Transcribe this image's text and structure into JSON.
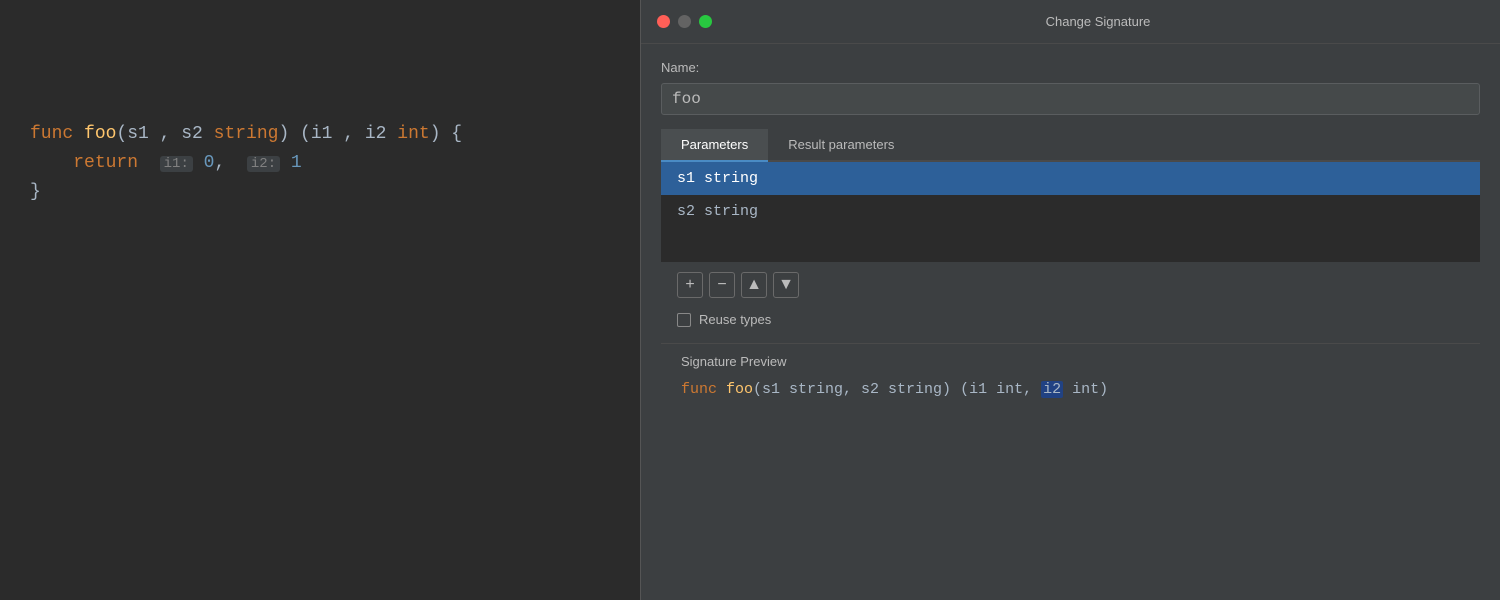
{
  "editor": {
    "lines": [
      {
        "id": "line1",
        "content": ""
      },
      {
        "id": "line2",
        "content": ""
      },
      {
        "id": "line3",
        "content": ""
      },
      {
        "id": "line4",
        "content": "func foo(s1 , s2 string) (i1 , i2 int) {"
      },
      {
        "id": "line5",
        "content": "    return  i1: 0,  i2: 1"
      },
      {
        "id": "line6",
        "content": "}"
      }
    ]
  },
  "dialog": {
    "title": "Change Signature",
    "title_bar_buttons": {
      "close": "close",
      "minimize": "minimize",
      "maximize": "maximize"
    },
    "name_label": "Name:",
    "name_value": "foo",
    "tabs": [
      {
        "id": "parameters",
        "label": "Parameters",
        "active": true
      },
      {
        "id": "result_parameters",
        "label": "Result parameters",
        "active": false
      }
    ],
    "parameters": [
      {
        "id": "p1",
        "value": "s1 string",
        "selected": true
      },
      {
        "id": "p2",
        "value": "s2 string",
        "selected": false
      }
    ],
    "toolbar": {
      "add": "+",
      "remove": "−",
      "move_up": "▲",
      "move_down": "▼"
    },
    "reuse_types_label": "Reuse types",
    "signature_preview_label": "Signature Preview",
    "signature_preview": {
      "keyword": "func",
      "name": "foo",
      "params": "(s1 string, s2 string) (i1 int,",
      "highlighted": "i2",
      "after": "int)"
    }
  }
}
